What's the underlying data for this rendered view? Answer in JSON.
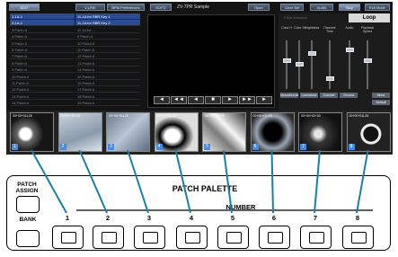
{
  "toolbar": {
    "buttons": [
      "EDIT",
      "V-LINK",
      "BPM Preferences",
      "EDIT2",
      "Open",
      "Clear Set",
      "Audio",
      "Stop",
      "Exit Mode"
    ],
    "title": "ZV-7PR Sample"
  },
  "clips": [
    {
      "name": "1-1A-1",
      "sub": "11-1A for SBR Key 1",
      "on": true
    },
    {
      "name": "2-1A-1",
      "sub": "11-1A for SBR Key 2",
      "on": true
    },
    {
      "name": "3 Patch A",
      "sub": "11 1A for...",
      "on": false
    },
    {
      "name": "4 Patch A",
      "sub": "6 Patch A",
      "on": false
    },
    {
      "name": "5 Patch A",
      "sub": "10 Patch A",
      "on": false
    },
    {
      "name": "6 Patch A",
      "sub": "11 Patch A",
      "on": false
    },
    {
      "name": "7 Patch A",
      "sub": "12 Patch A",
      "on": false
    },
    {
      "name": "8 Patch A",
      "sub": "13 Patch A",
      "on": false
    },
    {
      "name": "9 Patch A",
      "sub": "14 Patch A",
      "on": false
    },
    {
      "name": "10 Patch A",
      "sub": "15 Patch A",
      "on": false
    },
    {
      "name": "11 Patch A",
      "sub": "16 Patch A",
      "on": false
    },
    {
      "name": "12 Patch A",
      "sub": "17 Patch A",
      "on": false
    },
    {
      "name": "13 Patch A",
      "sub": "18 Patch A",
      "on": false
    },
    {
      "name": "14 Patch A",
      "sub": "19 Patch A",
      "on": false
    }
  ],
  "transport": [
    "◄",
    "◄◄",
    "◄",
    "■",
    "►",
    "►►",
    "►"
  ],
  "right_panel": {
    "clear_label": "Clear Distance",
    "loop_label": "Loop",
    "faders": [
      "Color H",
      "Color S",
      "Brightness",
      "Dissolve Time",
      "Audio",
      "Playback Speed"
    ],
    "buttons": [
      "Monochrome",
      "Luminance",
      "Colorize",
      "Chroma",
      "Mono",
      "Default"
    ]
  },
  "thumbs": [
    {
      "label": "00+00+01LZ6",
      "num": "1"
    },
    {
      "label": "00+00+35+00",
      "num": "2"
    },
    {
      "label": "00+00+01LZ6",
      "num": "3"
    },
    {
      "label": "00+00+05LZ6",
      "num": "4"
    },
    {
      "label": "00+00+02+00",
      "num": "5"
    },
    {
      "label": "00+00+02+00",
      "num": "6"
    },
    {
      "label": "00+00+02+00",
      "num": "7"
    },
    {
      "label": "00+00+01LZ6",
      "num": "8"
    }
  ],
  "hardware": {
    "patch_assign": "PATCH\nASSIGN",
    "bank": "BANK",
    "palette_title": "PATCH PALETTE",
    "number_label": "NUMBER",
    "numbers": [
      "1",
      "2",
      "3",
      "4",
      "5",
      "6",
      "7",
      "8"
    ]
  },
  "colors": {
    "accent": "#1a7fa8",
    "selected_row": "#2c4c92"
  }
}
